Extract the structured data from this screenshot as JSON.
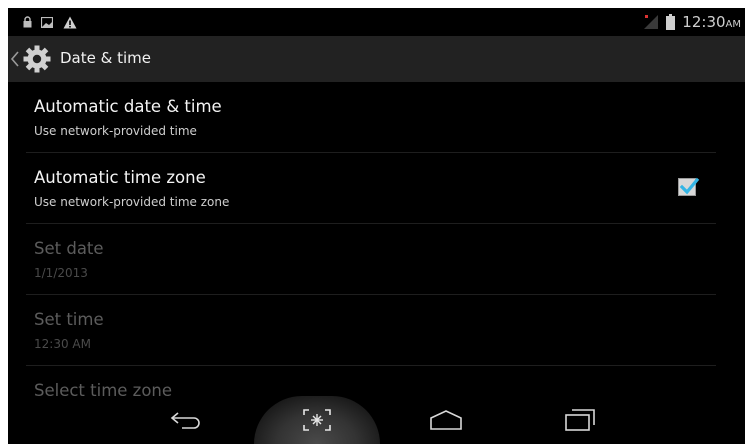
{
  "status_bar": {
    "time": "12:30",
    "ampm": "AM",
    "left_icons": [
      "lock-icon",
      "image-icon",
      "warning-icon"
    ],
    "right_icons": [
      "signal-icon",
      "battery-icon"
    ]
  },
  "action_bar": {
    "title": "Date & time",
    "icon": "settings-gear-icon"
  },
  "settings": [
    {
      "title": "Automatic date & time",
      "summary": "Use network-provided time",
      "enabled": true,
      "checked": false
    },
    {
      "title": "Automatic time zone",
      "summary": "Use network-provided time zone",
      "enabled": true,
      "checked": true
    },
    {
      "title": "Set date",
      "summary": "1/1/2013",
      "enabled": false
    },
    {
      "title": "Set time",
      "summary": "12:30 AM",
      "enabled": false
    },
    {
      "title": "Select time zone",
      "summary": "",
      "enabled": false
    }
  ],
  "colors": {
    "accent": "#33b5e5",
    "background": "#000000",
    "action_bar": "#222222"
  },
  "nav_bar": {
    "buttons": [
      "back-icon",
      "screenshot-icon",
      "home-icon",
      "recent-apps-icon"
    ]
  }
}
